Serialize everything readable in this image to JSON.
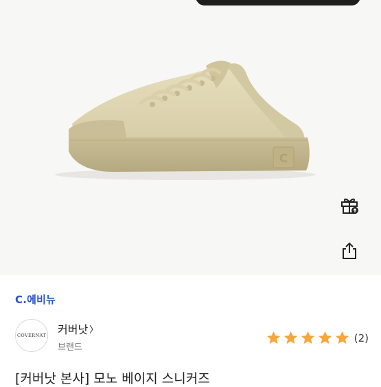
{
  "product": {
    "title": "[커버낫 본사] 모노 베이지 스니커즈",
    "image_alt": "COVERNAT mono beige low-top sneaker"
  },
  "seller_tag": "C.에비뉴",
  "shop": {
    "logo_text": "COVERNAT",
    "name": "커버낫",
    "chevron": "〉",
    "subtitle": "브랜드"
  },
  "rating": {
    "stars": 5,
    "max_stars": 5,
    "review_count": "(2)"
  },
  "actions": {
    "gift_icon": "gift-icon",
    "share_icon": "share-icon"
  },
  "colors": {
    "accent_blue": "#2b52c8",
    "star_orange": "#f4a73a",
    "shoe_beige": "#ddd4b0",
    "sole_khaki": "#c2b68e"
  }
}
